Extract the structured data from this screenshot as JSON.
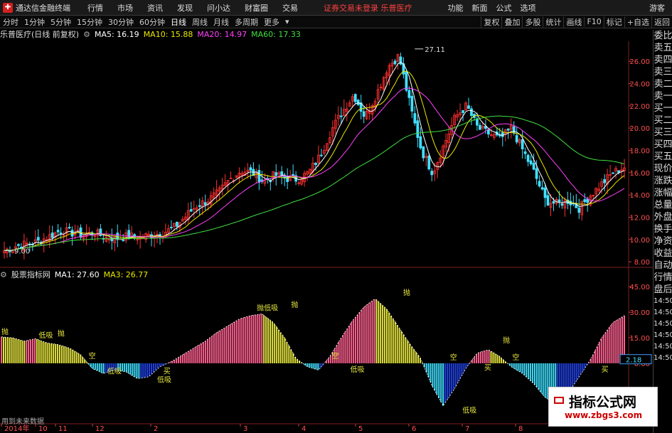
{
  "menubar": {
    "app_title": "通达信金融终端",
    "items": [
      "行情",
      "市场",
      "资讯",
      "发现",
      "问小达",
      "财富圈",
      "交易"
    ],
    "notice": "证券交易未登录  乐普医疗",
    "right_items": [
      "功能",
      "新面",
      "公式",
      "选项"
    ],
    "guest": "游客"
  },
  "tabbar": {
    "tabs": [
      "分时",
      "1分钟",
      "5分钟",
      "15分钟",
      "30分钟",
      "60分钟",
      "日线",
      "周线",
      "月线",
      "多周期",
      "更多"
    ],
    "active": "日线",
    "right_tabs": [
      "复权",
      "叠加",
      "多股",
      "统计",
      "画线",
      "F10",
      "标记",
      "+自选",
      "返回"
    ]
  },
  "chart_header": {
    "title": "乐普医疗(日线 前复权)",
    "ma5": "MA5: 16.19",
    "ma10": "MA10: 15.88",
    "ma20": "MA20: 14.97",
    "ma60": "MA60: 17.33",
    "ma5_color": "#ffffff",
    "ma10_color": "#e8e800",
    "ma20_color": "#ff40ff",
    "ma60_color": "#40e040"
  },
  "indicator_header": {
    "title": "股票指标网",
    "ma1": "MA1: 27.60",
    "ma3": "MA3: 26.77"
  },
  "right_panel": [
    "委比",
    "卖五",
    "卖四",
    "卖三",
    "卖二",
    "卖一",
    "买一",
    "买二",
    "买三",
    "买四",
    "买五",
    "现价",
    "涨跌",
    "涨幅",
    "总量",
    "外盘",
    "换手",
    "净资",
    "收益",
    "自动",
    "行情",
    "盘后",
    "14:50",
    "14:50",
    "14:50",
    "14:50",
    "14:50",
    "14:50"
  ],
  "footer_note": "用到未来数据",
  "watermark": {
    "line1": "指标公式网",
    "line2": "www.zbgs3.com"
  },
  "colors": {
    "up": "#ff3030",
    "down": "#40e8ff",
    "pink": "#ff6090",
    "yellow": "#e8e840",
    "blue": "#2040e0",
    "cyan": "#40e0ff"
  },
  "chart_data": [
    {
      "type": "candlestick",
      "title": "乐普医疗(日线 前复权)",
      "y_ticks": [
        26.0,
        24.0,
        22.0,
        20.0,
        18.0,
        16.0,
        14.0,
        12.0,
        10.0,
        8.0
      ],
      "ylim": [
        7.5,
        27.8
      ],
      "x_ticks": [
        "2014年",
        "10",
        "11",
        "12",
        "2",
        "3",
        "4",
        "5",
        "6",
        "7",
        "8"
      ],
      "annotations": [
        {
          "label": "27.11",
          "x": 0.662,
          "y": 27.11
        },
        {
          "label": "9.00",
          "x": 0.0,
          "y": 9.0
        }
      ],
      "close_approx": [
        9.0,
        9.4,
        9.6,
        9.8,
        10.3,
        10.8,
        10.6,
        10.4,
        10.6,
        10.2,
        10.1,
        10.3,
        10.2,
        10.4,
        10.6,
        11.0,
        12.0,
        13.0,
        13.5,
        14.2,
        15.4,
        16.2,
        16.0,
        15.2,
        15.8,
        15.5,
        15.4,
        16.0,
        17.5,
        19.8,
        21.5,
        23.0,
        21.0,
        23.0,
        25.5,
        26.5,
        22.0,
        18.0,
        16.0,
        18.5,
        21.0,
        22.0,
        20.0,
        19.5,
        19.0,
        20.0,
        18.0,
        16.0,
        13.5,
        13.2,
        13.5,
        12.8,
        14.0,
        15.0,
        16.0,
        16.5
      ],
      "series": [
        {
          "name": "MA5",
          "values": [
            16.19
          ]
        },
        {
          "name": "MA10",
          "values": [
            15.88
          ]
        },
        {
          "name": "MA20",
          "values": [
            14.97
          ]
        },
        {
          "name": "MA60",
          "values": [
            17.33
          ]
        }
      ]
    },
    {
      "type": "bar",
      "title": "股票指标网",
      "y_ticks": [
        45.0,
        30.0,
        15.0,
        0.0,
        -15.0
      ],
      "ylim": [
        -28,
        48
      ],
      "current_value": "2.18",
      "values_approx": [
        15.5,
        15.0,
        13.0,
        14.5,
        12.0,
        11.0,
        9.0,
        5.0,
        -3.0,
        -6.0,
        -4.0,
        -5.0,
        -9.0,
        -8.0,
        -2.0,
        1.0,
        5.0,
        9.0,
        13.0,
        18.0,
        22.0,
        26.0,
        28.0,
        29.0,
        24.0,
        15.0,
        3.0,
        -2.0,
        -4.0,
        4.0,
        15.0,
        25.0,
        33.0,
        38.0,
        32.0,
        22.0,
        12.0,
        3.0,
        -13.0,
        -25.0,
        -15.0,
        -3.0,
        6.0,
        8.0,
        4.0,
        -2.0,
        -6.0,
        -12.0,
        -20.0,
        -24.0,
        -18.0,
        -8.0,
        2.0,
        15.0,
        24.0,
        28.0
      ],
      "signals": [
        {
          "label": "抛",
          "x": 0.0,
          "y": 17.0
        },
        {
          "label": "低吸",
          "x": 0.06,
          "y": 15.0
        },
        {
          "label": "抛",
          "x": 0.09,
          "y": 16.0
        },
        {
          "label": "空",
          "x": 0.14,
          "y": 3.0
        },
        {
          "label": "低吸",
          "x": 0.17,
          "y": -6.0
        },
        {
          "label": "买",
          "x": 0.26,
          "y": -6.0
        },
        {
          "label": "低吸",
          "x": 0.25,
          "y": -11.0
        },
        {
          "label": "抛低吸",
          "x": 0.41,
          "y": 31.0
        },
        {
          "label": "抛",
          "x": 0.465,
          "y": 33.0
        },
        {
          "label": "空",
          "x": 0.53,
          "y": 3.0
        },
        {
          "label": "低吸",
          "x": 0.56,
          "y": -5.0
        },
        {
          "label": "抛",
          "x": 0.645,
          "y": 40.0
        },
        {
          "label": "空",
          "x": 0.72,
          "y": 2.0
        },
        {
          "label": "低吸",
          "x": 0.74,
          "y": -29.0
        },
        {
          "label": "抛",
          "x": 0.805,
          "y": 12.0
        },
        {
          "label": "买",
          "x": 0.775,
          "y": -4.0
        },
        {
          "label": "空",
          "x": 0.82,
          "y": 2.0
        },
        {
          "label": "买",
          "x": 0.963,
          "y": -5.0
        }
      ]
    }
  ]
}
